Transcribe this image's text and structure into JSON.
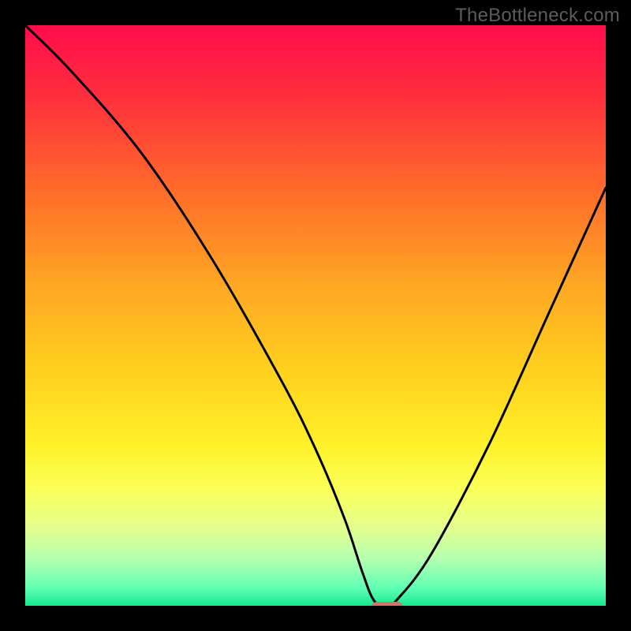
{
  "watermark": "TheBottleneck.com",
  "chart_data": {
    "type": "line",
    "title": "",
    "xlabel": "",
    "ylabel": "",
    "xlim": [
      0,
      100
    ],
    "ylim": [
      0,
      100
    ],
    "grid": false,
    "legend": false,
    "note": "V-shaped bottleneck curve over a vertical rainbow gradient; minimum near x≈62; axes are unlabeled.",
    "series": [
      {
        "name": "bottleneck-curve",
        "x": [
          0,
          8,
          20,
          32,
          44,
          50,
          55,
          58,
          60,
          62,
          64,
          70,
          80,
          90,
          100
        ],
        "values": [
          100,
          92,
          78,
          60,
          39,
          27,
          15,
          6,
          1,
          0,
          1,
          9,
          28,
          50,
          72
        ]
      }
    ],
    "marker": {
      "x": 62,
      "y": 0,
      "color": "#d5736b",
      "shape": "rounded-bar"
    },
    "gradient_stops": [
      {
        "pos": 0.0,
        "color": "#ff0c4b"
      },
      {
        "pos": 0.12,
        "color": "#ff2e3e"
      },
      {
        "pos": 0.28,
        "color": "#ff6a2a"
      },
      {
        "pos": 0.45,
        "color": "#ffa823"
      },
      {
        "pos": 0.6,
        "color": "#ffd21e"
      },
      {
        "pos": 0.72,
        "color": "#fff028"
      },
      {
        "pos": 0.8,
        "color": "#fbff5a"
      },
      {
        "pos": 0.86,
        "color": "#e7ff8a"
      },
      {
        "pos": 0.92,
        "color": "#b3ffb0"
      },
      {
        "pos": 0.97,
        "color": "#5effb3"
      },
      {
        "pos": 1.0,
        "color": "#15e98e"
      }
    ]
  }
}
